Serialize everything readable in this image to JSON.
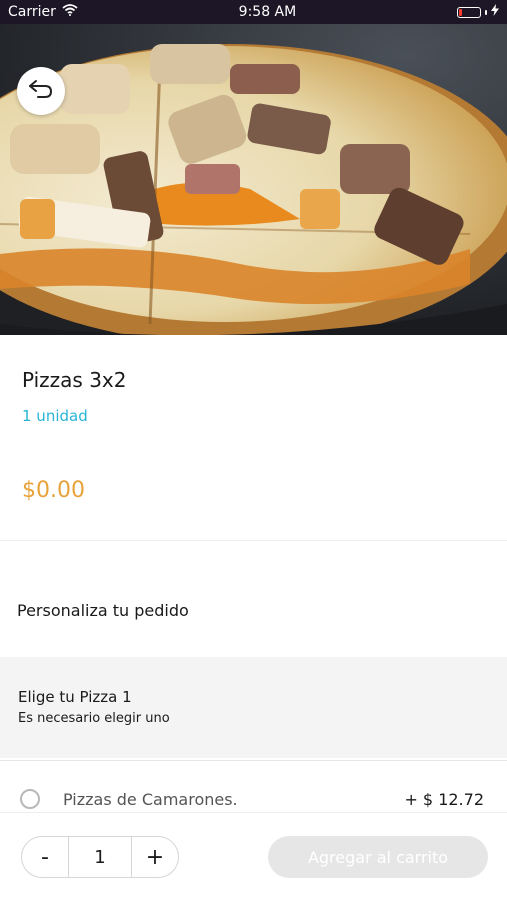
{
  "status_bar": {
    "carrier": "Carrier",
    "time": "9:58 AM"
  },
  "product": {
    "name": "Pizzas 3x2",
    "unit": "1 unidad",
    "price": "$0.00"
  },
  "customize": {
    "title": "Personaliza tu pedido"
  },
  "section": {
    "title": "Elige tu Pizza 1",
    "subtitle": "Es necesario elegir uno"
  },
  "options": [
    {
      "label": "Pizzas de Camarones.",
      "price": "+ $ 12.72",
      "selected": false
    }
  ],
  "cart": {
    "quantity": "1",
    "minus": "-",
    "plus": "+",
    "add_label": "Agregar al carrito"
  },
  "colors": {
    "accent_cyan": "#29b6d6",
    "price_orange": "#e8a23a",
    "disabled_button": "#e6e6e6",
    "status_bar": "#1c1626"
  },
  "icons": {
    "back": "undo-arrow-icon",
    "wifi": "wifi-icon",
    "battery": "battery-icon",
    "charging": "charging-bolt-icon"
  }
}
